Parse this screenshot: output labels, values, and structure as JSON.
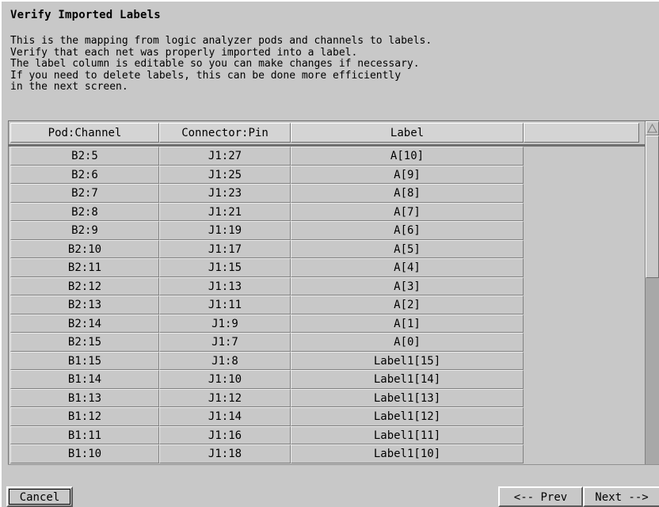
{
  "dialog": {
    "title": "Verify Imported Labels",
    "description_lines": [
      "This is the mapping from logic analyzer pods and channels to labels.",
      "Verify that each net was properly imported into a label.",
      "The label column is editable so you can make changes if necessary.",
      "If you need to delete labels, this can be done more efficiently",
      "in the next screen."
    ]
  },
  "table": {
    "headers": [
      "Pod:Channel",
      "Connector:Pin",
      "Label",
      ""
    ],
    "rows": [
      [
        "B2:5",
        "J1:27",
        "A[10]"
      ],
      [
        "B2:6",
        "J1:25",
        "A[9]"
      ],
      [
        "B2:7",
        "J1:23",
        "A[8]"
      ],
      [
        "B2:8",
        "J1:21",
        "A[7]"
      ],
      [
        "B2:9",
        "J1:19",
        "A[6]"
      ],
      [
        "B2:10",
        "J1:17",
        "A[5]"
      ],
      [
        "B2:11",
        "J1:15",
        "A[4]"
      ],
      [
        "B2:12",
        "J1:13",
        "A[3]"
      ],
      [
        "B2:13",
        "J1:11",
        "A[2]"
      ],
      [
        "B2:14",
        "J1:9",
        "A[1]"
      ],
      [
        "B2:15",
        "J1:7",
        "A[0]"
      ],
      [
        "B1:15",
        "J1:8",
        "Label1[15]"
      ],
      [
        "B1:14",
        "J1:10",
        "Label1[14]"
      ],
      [
        "B1:13",
        "J1:12",
        "Label1[13]"
      ],
      [
        "B1:12",
        "J1:14",
        "Label1[12]"
      ],
      [
        "B1:11",
        "J1:16",
        "Label1[11]"
      ],
      [
        "B1:10",
        "J1:18",
        "Label1[10]"
      ]
    ]
  },
  "buttons": {
    "cancel": "Cancel",
    "prev": "<-- Prev",
    "next": "Next -->"
  }
}
